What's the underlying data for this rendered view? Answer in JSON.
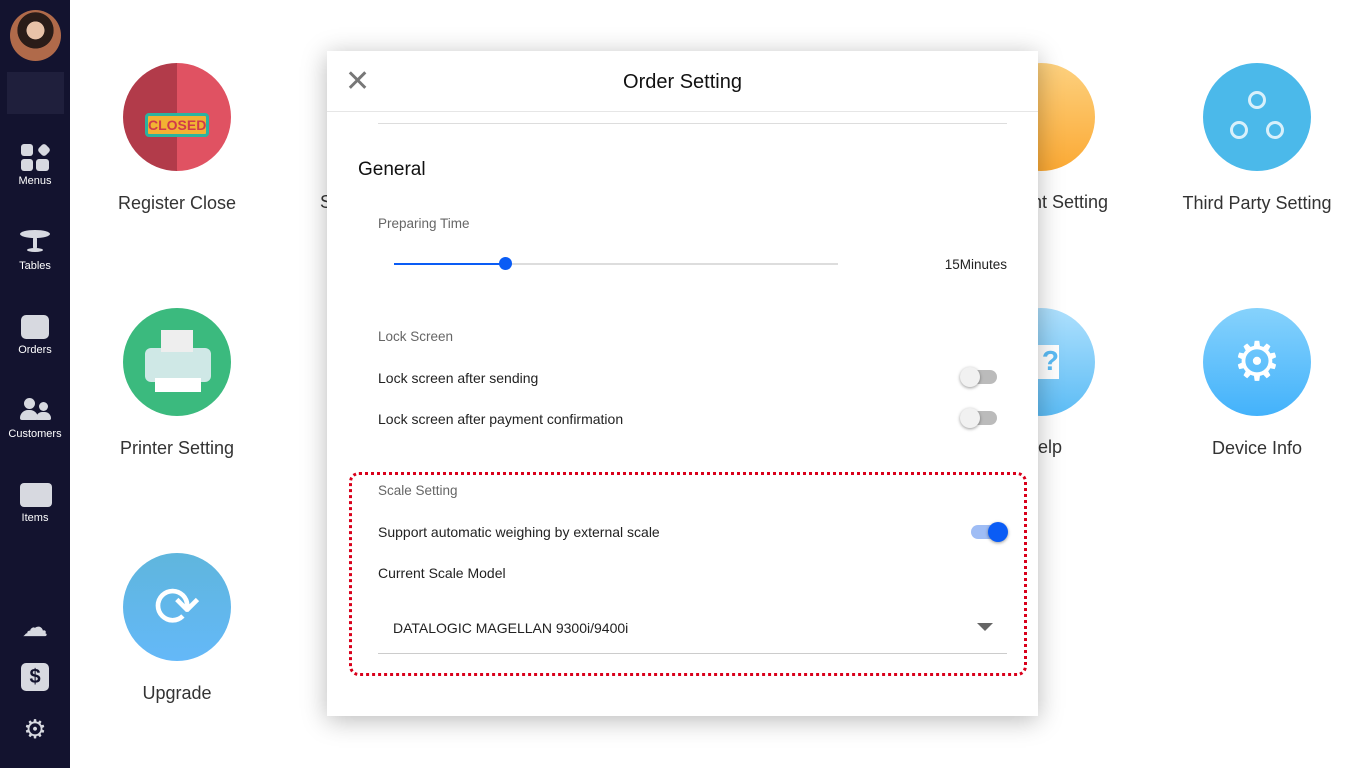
{
  "sidebar": {
    "items": [
      {
        "label": "Menus",
        "icon": "menus-icon"
      },
      {
        "label": "Tables",
        "icon": "table-icon"
      },
      {
        "label": "Orders",
        "icon": "orders-icon"
      },
      {
        "label": "Customers",
        "icon": "customers-icon"
      },
      {
        "label": "Items",
        "icon": "items-icon"
      }
    ],
    "bottom_icons": [
      "cloud-check-icon",
      "cash-drawer-icon",
      "gear-icon"
    ]
  },
  "tiles": {
    "register_close": "Register Close",
    "closed_sign": "CLOSED",
    "printer_setting": "Printer Setting",
    "upgrade": "Upgrade",
    "third_party": "Third Party Setting",
    "device_info": "Device Info",
    "partial_s": "S",
    "partial_payment": "nt Setting",
    "partial_help": "elp"
  },
  "modal": {
    "title": "Order Setting",
    "section": "General",
    "preparing_label": "Preparing Time",
    "preparing_value": "15Minutes",
    "preparing_fraction": 0.25,
    "lock_label": "Lock Screen",
    "lock_after_sending": "Lock screen after sending",
    "lock_after_payment": "Lock screen after payment confirmation",
    "lock_after_sending_on": false,
    "lock_after_payment_on": false,
    "scale_label": "Scale Setting",
    "scale_support": "Support automatic weighing by external scale",
    "scale_support_on": true,
    "scale_model_label": "Current Scale Model",
    "scale_model": "DATALOGIC MAGELLAN 9300i/9400i"
  },
  "colors": {
    "accent": "#0a5cf5",
    "sidebar": "#13132f",
    "highlight": "#d9001b"
  }
}
